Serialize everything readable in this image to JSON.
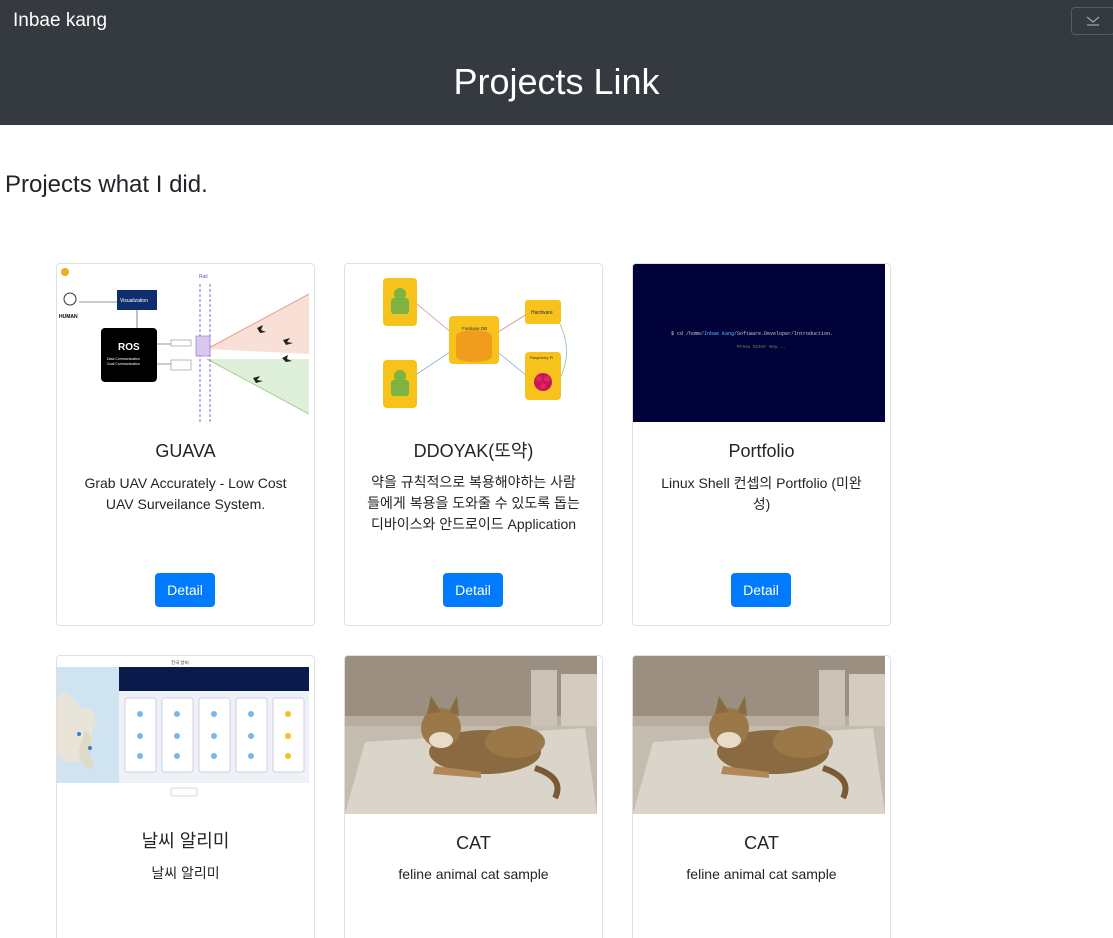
{
  "navbar": {
    "brand": "Inbae kang",
    "toggle_icon": "chevron-down-icon"
  },
  "hero": {
    "title": "Projects Link"
  },
  "section": {
    "subtitle": "Projects what I did."
  },
  "cards": [
    {
      "title": "GUAVA",
      "text": "Grab UAV Accurately - Low Cost UAV Surveilance System.",
      "button": "Detail",
      "image": {
        "labels": [
          "HUMAN",
          "Visualization",
          "ROS",
          "Data Communication",
          "Goal Communication",
          "Rail"
        ]
      }
    },
    {
      "title": "DDOYAK(또약)",
      "text": "약을 규칙적으로 복용해야하는 사람들에게 복용을 도와줄 수 있도록 돕는 디바이스와 안드로이드 Application",
      "button": "Detail",
      "image": {
        "labels": [
          "Firebase DB",
          "Hardware",
          "Raspberry Pi"
        ]
      }
    },
    {
      "title": "Portfolio",
      "text": "Linux Shell 컨셉의 Portfolio (미완성)",
      "button": "Detail",
      "image": {
        "line1_prefix": "$ cd /home/",
        "line1_highlight": "Inbae Kang",
        "line1_suffix": "/Software.Developer/Introduction.",
        "line2": "Press Enter Key..."
      }
    },
    {
      "title": "날씨 알리미",
      "text": "날씨 알리미",
      "image": {
        "header": "전국 날씨"
      }
    },
    {
      "title": "CAT",
      "text": "feline animal cat sample"
    },
    {
      "title": "CAT",
      "text": "feline animal cat sample"
    }
  ],
  "colors": {
    "navbar_bg": "#343a40",
    "primary": "#007bff",
    "terminal_bg": "#02023a"
  }
}
